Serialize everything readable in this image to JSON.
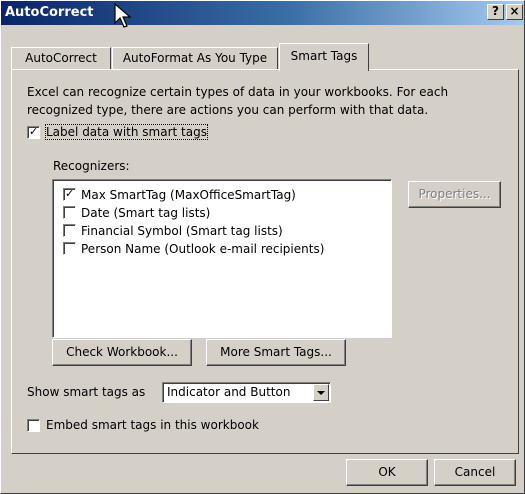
{
  "window": {
    "title": "AutoCorrect",
    "help_label": "?",
    "close_label": "×"
  },
  "tabs": [
    {
      "label": "AutoCorrect",
      "active": false
    },
    {
      "label": "AutoFormat As You Type",
      "active": false
    },
    {
      "label": "Smart Tags",
      "active": true
    }
  ],
  "smart_tags": {
    "description": "Excel can recognize certain types of data in your workbooks.  For each recognized type, there are actions you can perform with that data.",
    "label_checkbox": {
      "label": "Label data with smart tags",
      "checked": true
    },
    "recognizers_label": "Recognizers:",
    "recognizers": [
      {
        "label": "Max SmartTag (MaxOfficeSmartTag)",
        "checked": true
      },
      {
        "label": "Date (Smart tag lists)",
        "checked": false
      },
      {
        "label": "Financial Symbol (Smart tag lists)",
        "checked": false
      },
      {
        "label": "Person Name (Outlook e-mail recipients)",
        "checked": false
      }
    ],
    "properties_button": "Properties...",
    "check_workbook_button": "Check Workbook...",
    "more_smart_tags_button": "More Smart Tags...",
    "show_as_label": "Show smart tags as",
    "show_as_value": "Indicator and Button",
    "embed_checkbox": {
      "label": "Embed smart tags in this workbook",
      "checked": false
    }
  },
  "footer": {
    "ok_label": "OK",
    "cancel_label": "Cancel"
  },
  "colors": {
    "face": "#d4d0c8",
    "title_start": "#0a246a",
    "title_end": "#a6caf0"
  }
}
